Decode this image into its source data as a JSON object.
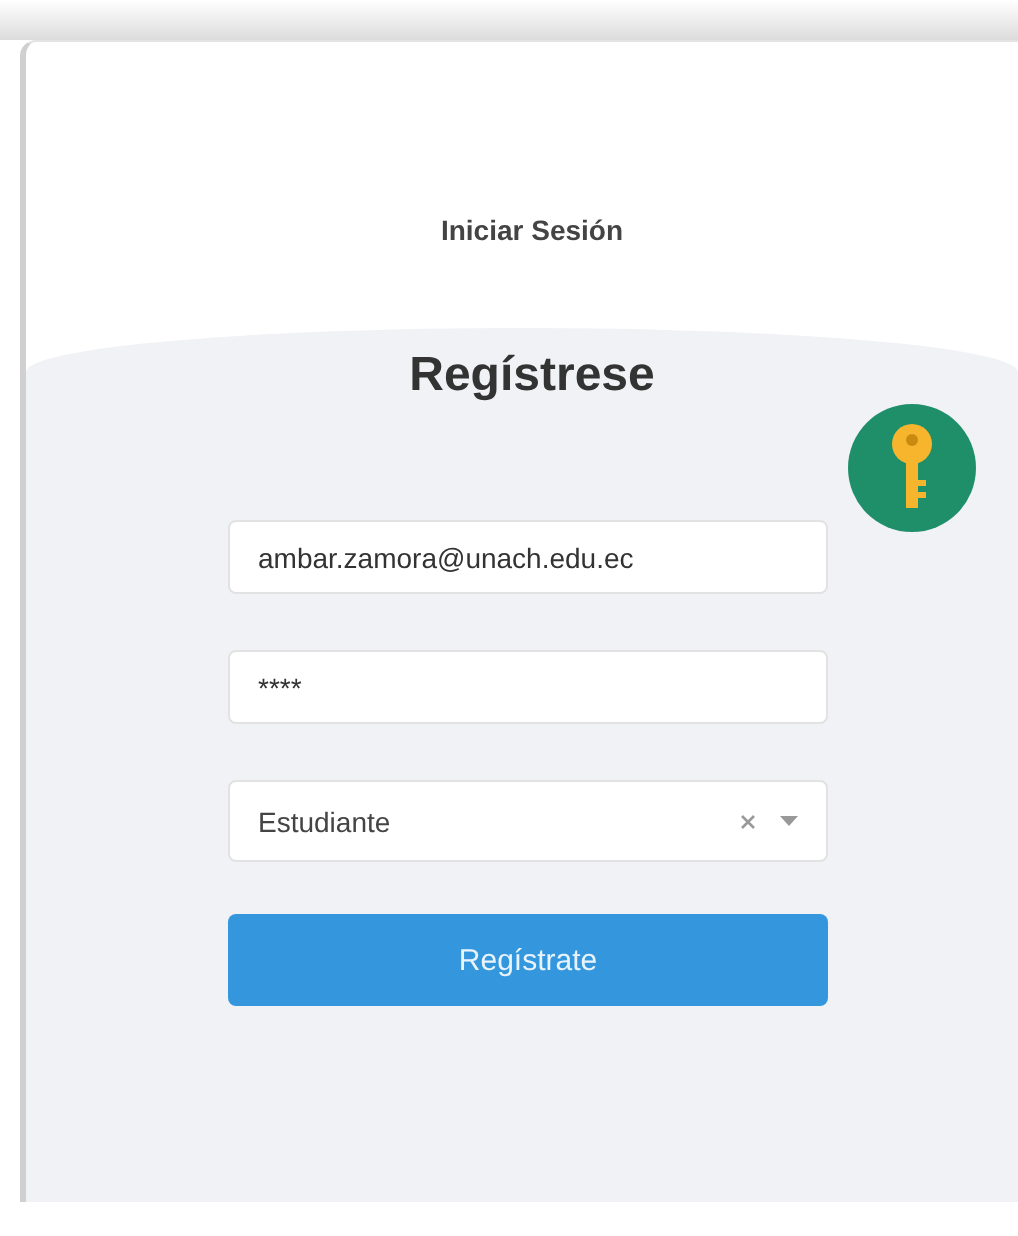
{
  "login_link": "Iniciar Sesión",
  "title": "Regístrese",
  "form": {
    "email": {
      "value": "ambar.zamora@unach.edu.ec"
    },
    "password": {
      "value": "****"
    },
    "role": {
      "value": "Estudiante",
      "clearable": true
    },
    "submit": "Regístrate"
  }
}
